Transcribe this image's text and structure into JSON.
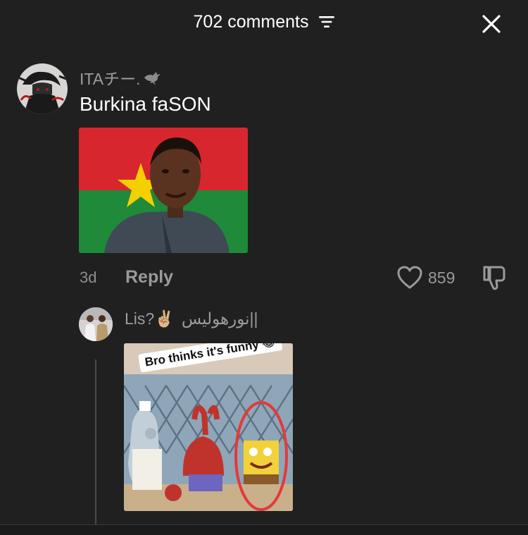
{
  "header": {
    "title": "702 comments"
  },
  "comment": {
    "username": "ITAチー.",
    "text": "Burkina faSON",
    "time": "3d",
    "reply_label": "Reply",
    "like_count": "859"
  },
  "reply": {
    "username": "Lis?✌🏼",
    "username_alt": "نورهوليس||",
    "meme_caption": "Bro thinks it's funny 😂"
  },
  "colors": {
    "background": "#202020",
    "secondary_text": "#9a9a9a",
    "flag_red": "#d8262e",
    "flag_green": "#1e8a3a",
    "flag_star": "#f4d000"
  }
}
